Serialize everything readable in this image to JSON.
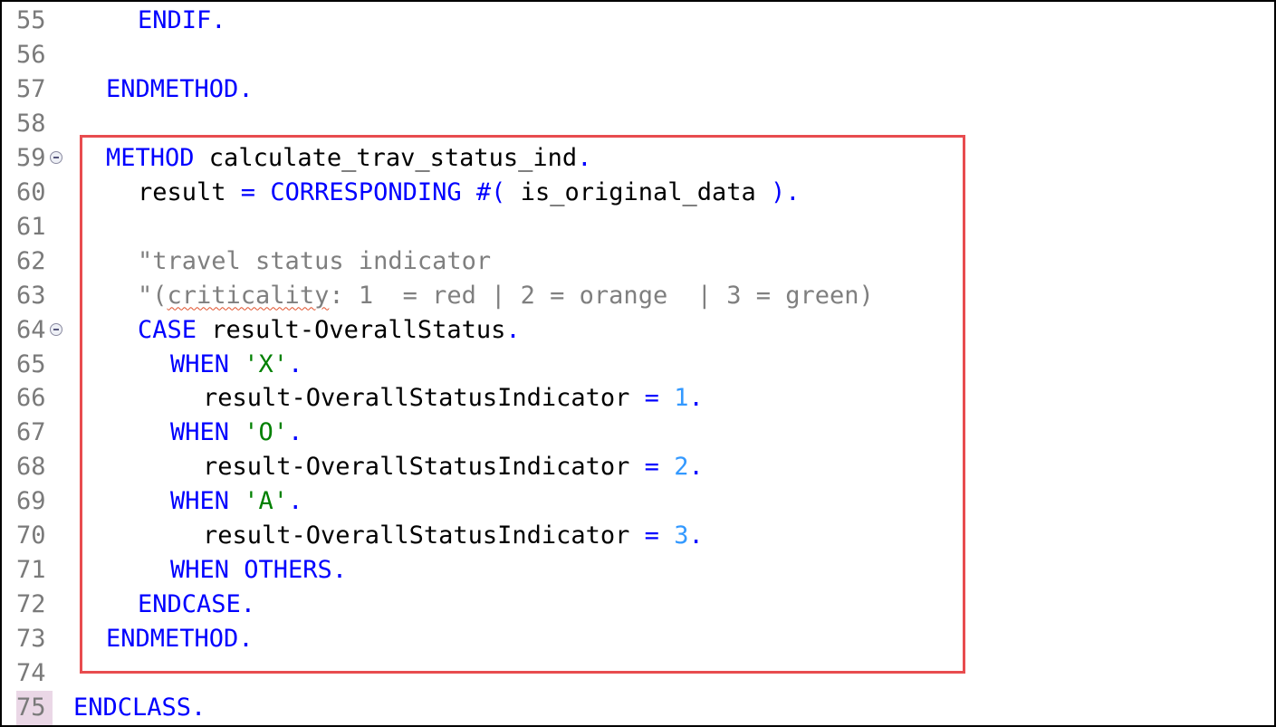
{
  "editor": {
    "lines": [
      {
        "number": "55",
        "parts": [
          {
            "t": "ENDIF",
            "c": "kw"
          },
          {
            "t": ".",
            "c": "kw"
          }
        ]
      },
      {
        "number": "56",
        "parts": []
      },
      {
        "number": "57",
        "parts": [
          {
            "t": "ENDMETHOD",
            "c": "kw"
          },
          {
            "t": ".",
            "c": "kw"
          }
        ]
      },
      {
        "number": "58",
        "parts": []
      },
      {
        "number": "59",
        "fold": true,
        "parts": [
          {
            "t": "METHOD",
            "c": "kw"
          },
          {
            "t": " calculate_trav_status_ind",
            "c": "id"
          },
          {
            "t": ".",
            "c": "kw"
          }
        ]
      },
      {
        "number": "60",
        "parts": [
          {
            "t": "result",
            "c": "id"
          },
          {
            "t": " = ",
            "c": "kw"
          },
          {
            "t": "CORRESPONDING",
            "c": "kw"
          },
          {
            "t": " #( ",
            "c": "kw"
          },
          {
            "t": "is_original_data",
            "c": "id"
          },
          {
            "t": " ).",
            "c": "kw"
          }
        ]
      },
      {
        "number": "61",
        "parts": []
      },
      {
        "number": "62",
        "parts": [
          {
            "t": "\"travel status indicator",
            "c": "cm"
          }
        ]
      },
      {
        "number": "63",
        "parts": [
          {
            "t": "\"(",
            "c": "cm"
          },
          {
            "t": "criticality",
            "c": "cm spell"
          },
          {
            "t": ": 1  = red | 2 = orange  | 3 = green)",
            "c": "cm"
          }
        ]
      },
      {
        "number": "64",
        "fold": true,
        "parts": [
          {
            "t": "CASE",
            "c": "kw"
          },
          {
            "t": " result-OverallStatus",
            "c": "id"
          },
          {
            "t": ".",
            "c": "kw"
          }
        ]
      },
      {
        "number": "65",
        "parts": [
          {
            "t": "WHEN",
            "c": "kw"
          },
          {
            "t": " ",
            "c": "id"
          },
          {
            "t": "'X'",
            "c": "st"
          },
          {
            "t": ".",
            "c": "kw"
          }
        ]
      },
      {
        "number": "66",
        "parts": [
          {
            "t": "result-OverallStatusIndicator",
            "c": "id"
          },
          {
            "t": " = ",
            "c": "kw"
          },
          {
            "t": "1",
            "c": "nm"
          },
          {
            "t": ".",
            "c": "kw"
          }
        ]
      },
      {
        "number": "67",
        "parts": [
          {
            "t": "WHEN",
            "c": "kw"
          },
          {
            "t": " ",
            "c": "id"
          },
          {
            "t": "'O'",
            "c": "st"
          },
          {
            "t": ".",
            "c": "kw"
          }
        ]
      },
      {
        "number": "68",
        "parts": [
          {
            "t": "result-OverallStatusIndicator",
            "c": "id"
          },
          {
            "t": " = ",
            "c": "kw"
          },
          {
            "t": "2",
            "c": "nm"
          },
          {
            "t": ".",
            "c": "kw"
          }
        ]
      },
      {
        "number": "69",
        "parts": [
          {
            "t": "WHEN",
            "c": "kw"
          },
          {
            "t": " ",
            "c": "id"
          },
          {
            "t": "'A'",
            "c": "st"
          },
          {
            "t": ".",
            "c": "kw"
          }
        ]
      },
      {
        "number": "70",
        "parts": [
          {
            "t": "result-OverallStatusIndicator",
            "c": "id"
          },
          {
            "t": " = ",
            "c": "kw"
          },
          {
            "t": "3",
            "c": "nm"
          },
          {
            "t": ".",
            "c": "kw"
          }
        ]
      },
      {
        "number": "71",
        "parts": [
          {
            "t": "WHEN OTHERS",
            "c": "kw"
          },
          {
            "t": ".",
            "c": "kw"
          }
        ]
      },
      {
        "number": "72",
        "parts": [
          {
            "t": "ENDCASE",
            "c": "kw"
          },
          {
            "t": ".",
            "c": "kw"
          }
        ]
      },
      {
        "number": "73",
        "parts": [
          {
            "t": "ENDMETHOD",
            "c": "kw"
          },
          {
            "t": ".",
            "c": "kw"
          }
        ]
      },
      {
        "number": "74",
        "parts": []
      },
      {
        "number": "75",
        "current": true,
        "parts": [
          {
            "t": "ENDCLASS",
            "c": "kw"
          },
          {
            "t": ".",
            "c": "kw"
          }
        ]
      }
    ]
  },
  "colors": {
    "keyword": "#0000ff",
    "comment": "#7f7f7f",
    "string": "#008000",
    "number": "#3399ff",
    "highlight_box": "#e84c4f",
    "current_line_number_bg": "#ead7e6"
  }
}
